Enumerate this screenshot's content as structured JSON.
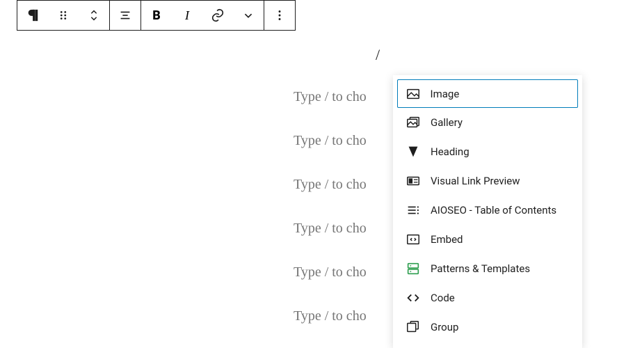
{
  "slash_text": "/",
  "placeholders": [
    {
      "text": "Type / to cho"
    },
    {
      "text": "Type / to cho"
    },
    {
      "text": "Type / to cho"
    },
    {
      "text": "Type / to cho"
    },
    {
      "text": "Type / to cho"
    },
    {
      "text": "Type / to cho"
    }
  ],
  "block_menu": {
    "items": [
      {
        "label": "Image",
        "selected": true
      },
      {
        "label": "Gallery",
        "selected": false
      },
      {
        "label": "Heading",
        "selected": false
      },
      {
        "label": "Visual Link Preview",
        "selected": false
      },
      {
        "label": "AIOSEO - Table of Contents",
        "selected": false
      },
      {
        "label": "Embed",
        "selected": false
      },
      {
        "label": "Patterns & Templates",
        "selected": false
      },
      {
        "label": "Code",
        "selected": false
      },
      {
        "label": "Group",
        "selected": false
      }
    ]
  },
  "toolbar": {
    "bold_label": "B",
    "italic_label": "I"
  }
}
